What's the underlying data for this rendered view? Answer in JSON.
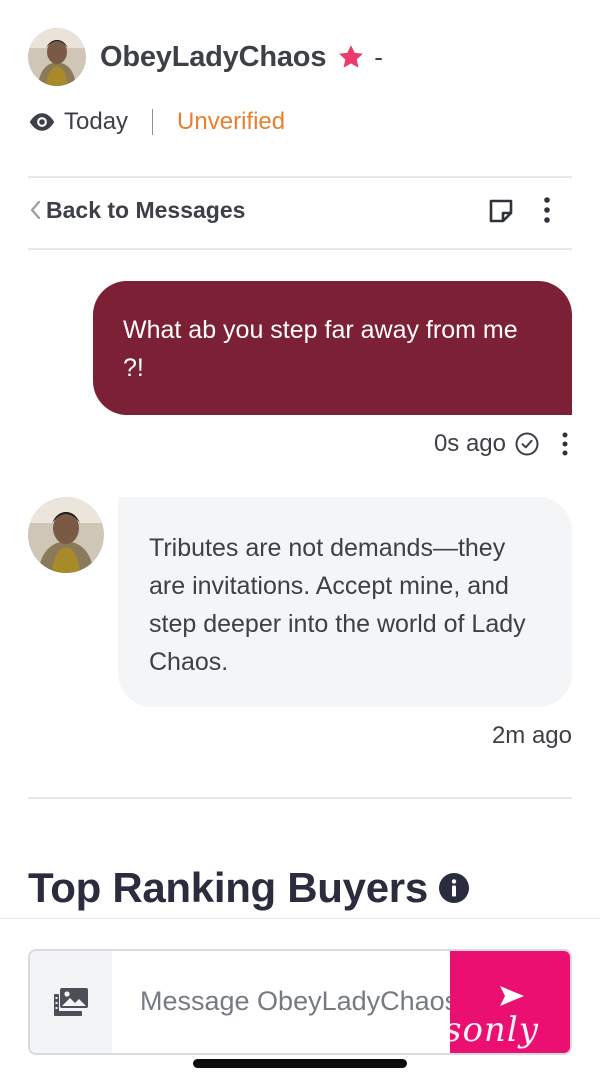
{
  "profile": {
    "name": "ObeyLadyChaos",
    "dash": "-",
    "last_seen": "Today",
    "verification": "Unverified",
    "star_color": "#ec3b6a",
    "verification_color": "#e9812a"
  },
  "nav": {
    "back_label": "Back to Messages",
    "note_icon": "sticky-note-icon",
    "more_icon": "more-vertical-icon"
  },
  "messages": [
    {
      "direction": "outgoing",
      "text": "What ab you step far away from me ?!",
      "time": "0s ago",
      "status_icon": "check-circle-icon",
      "bubble_color": "#7c2135"
    },
    {
      "direction": "incoming",
      "text": "Tributes are not demands—they are invitations. Accept mine, and step deeper into the world of Lady Chaos.",
      "time": "2m ago",
      "bubble_color": "#f4f5f7"
    }
  ],
  "ranking": {
    "title": "Top Ranking Buyers",
    "info_icon": "info-icon"
  },
  "composer": {
    "placeholder": "Message ObeyLadyChaos",
    "media_icon": "photo-gallery-icon",
    "send_icon": "send-icon",
    "send_color": "#ec0f72",
    "watermark": "sonly"
  }
}
